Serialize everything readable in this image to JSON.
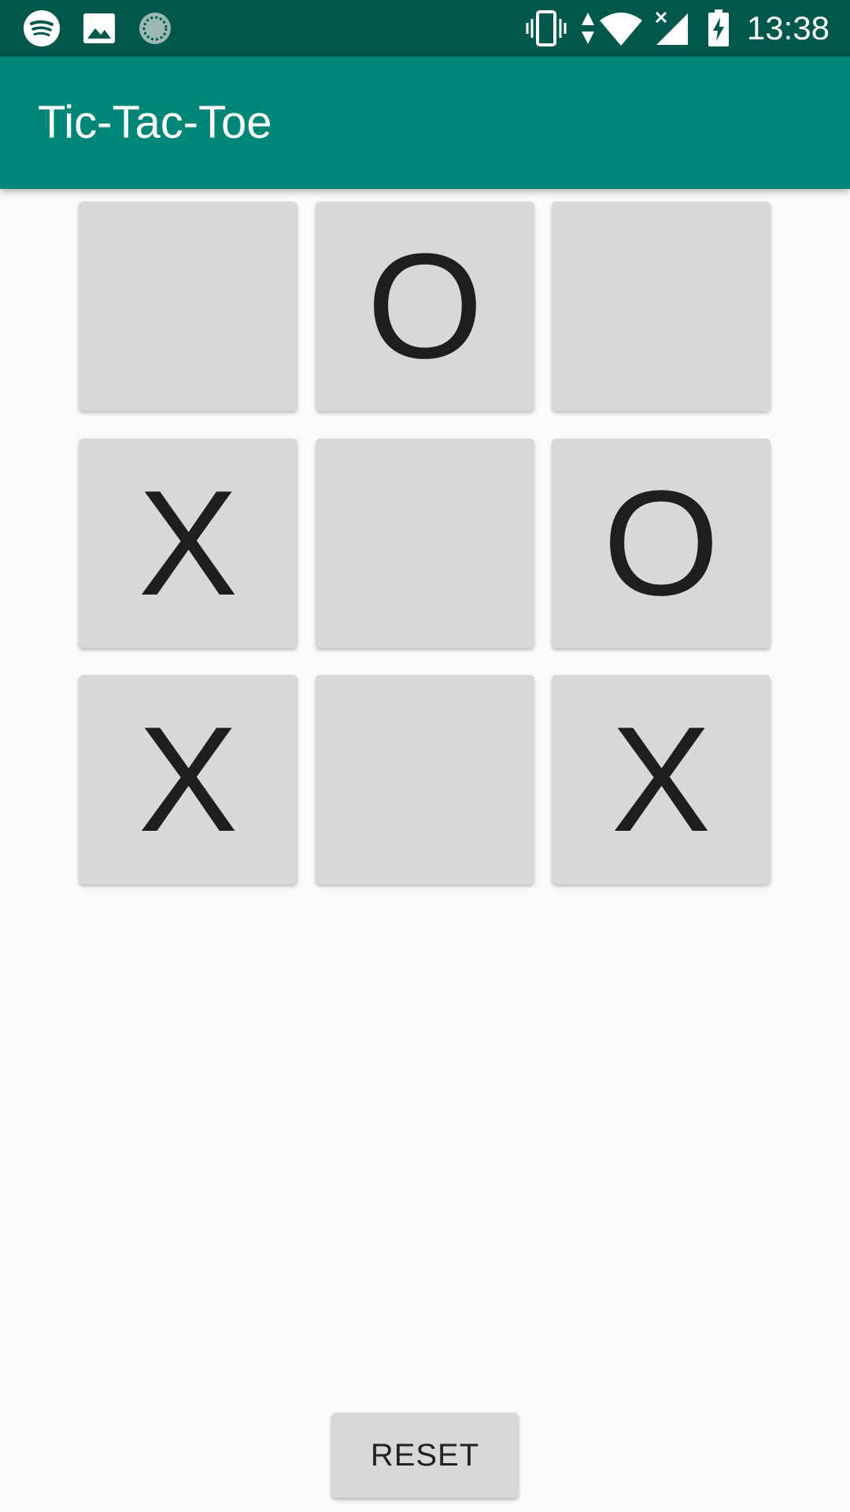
{
  "status_bar": {
    "time": "13:38",
    "icons": [
      "spotify-icon",
      "image-icon",
      "sync-progress-icon",
      "vibrate-icon",
      "data-arrows-icon",
      "wifi-icon",
      "cellular-no-signal-icon",
      "battery-charging-icon"
    ]
  },
  "app_bar": {
    "title": "Tic-Tac-Toe"
  },
  "board": {
    "cells": [
      [
        "",
        "O",
        ""
      ],
      [
        "X",
        "",
        "O"
      ],
      [
        "X",
        "",
        "X"
      ]
    ]
  },
  "reset_label": "RESET",
  "colors": {
    "status_bar": "#00574b",
    "app_bar": "#008577",
    "background": "#fafafa",
    "cell": "#d7d8d8",
    "mark": "#1e1e1e"
  }
}
